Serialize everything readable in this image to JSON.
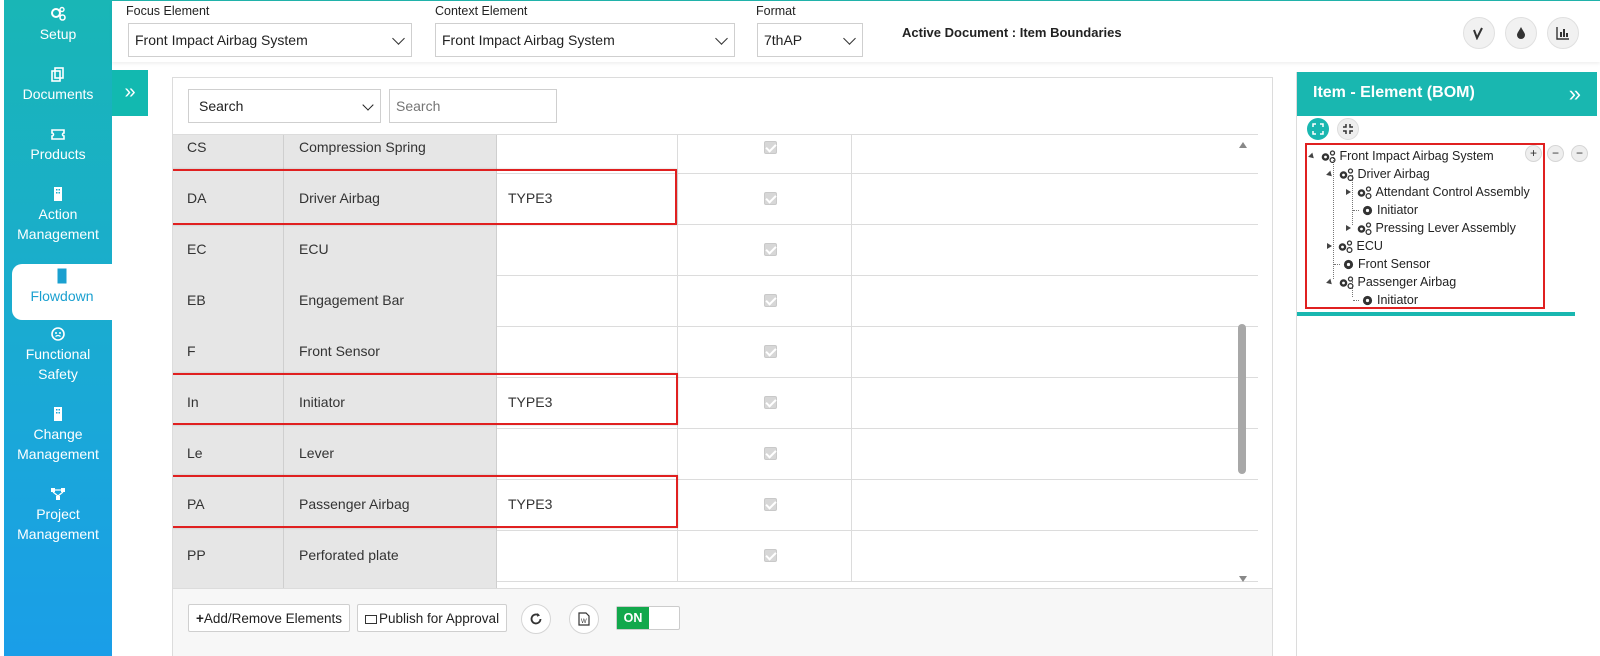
{
  "sidebar": {
    "items": [
      {
        "label": "Setup",
        "icon": "gears-icon"
      },
      {
        "label": "Documents",
        "icon": "copy-icon"
      },
      {
        "label": "Products",
        "icon": "ticket-icon"
      },
      {
        "label": "Action Management",
        "icon": "building-icon"
      },
      {
        "label": "Flowdown",
        "icon": "building-icon",
        "active": true
      },
      {
        "label": "Functional Safety",
        "icon": "face-icon"
      },
      {
        "label": "Change Management",
        "icon": "building-icon"
      },
      {
        "label": "Project Management",
        "icon": "sitemap-icon"
      }
    ]
  },
  "topbar": {
    "focus_label": "Focus Element",
    "focus_value": "Front Impact Airbag System",
    "context_label": "Context Element",
    "context_value": "Front Impact Airbag System",
    "format_label": "Format",
    "format_value": "7thAP",
    "active_document": "Active Document : Item Boundaries"
  },
  "search": {
    "select_value": "Search",
    "placeholder": "Search"
  },
  "table": {
    "rows": [
      {
        "code": "CS",
        "name": "Compression Spring",
        "type": ""
      },
      {
        "code": "DA",
        "name": "Driver Airbag",
        "type": "TYPE3"
      },
      {
        "code": "EC",
        "name": "ECU",
        "type": ""
      },
      {
        "code": "EB",
        "name": "Engagement Bar",
        "type": ""
      },
      {
        "code": "F",
        "name": "Front Sensor",
        "type": ""
      },
      {
        "code": "In",
        "name": "Initiator",
        "type": "TYPE3"
      },
      {
        "code": "Le",
        "name": "Lever",
        "type": ""
      },
      {
        "code": "PA",
        "name": "Passenger Airbag",
        "type": "TYPE3"
      },
      {
        "code": "PP",
        "name": "Perforated plate",
        "type": ""
      }
    ]
  },
  "bottom": {
    "add_remove": "Add/Remove Elements",
    "publish": "Publish for Approval",
    "toggle_on": "ON"
  },
  "bom": {
    "title": "Item - Element (BOM)",
    "tree": [
      {
        "label": "Front Impact Airbag System"
      },
      {
        "label": "Driver Airbag"
      },
      {
        "label": "Attendant Control Assembly"
      },
      {
        "label": "Initiator"
      },
      {
        "label": "Pressing Lever Assembly"
      },
      {
        "label": "ECU"
      },
      {
        "label": "Front Sensor"
      },
      {
        "label": "Passenger Airbag"
      },
      {
        "label": "Initiator"
      }
    ]
  },
  "colors": {
    "accent": "#19b7b0",
    "highlight": "#e02020",
    "toggle_on": "#12a84c"
  }
}
